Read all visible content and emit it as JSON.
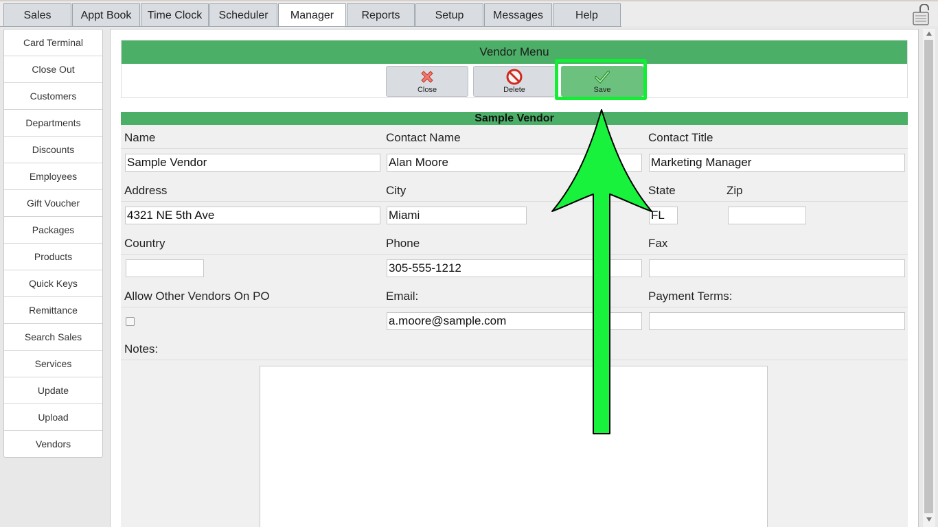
{
  "tabs": [
    {
      "label": "Sales",
      "active": false
    },
    {
      "label": "Appt Book",
      "active": false
    },
    {
      "label": "Time Clock",
      "active": false
    },
    {
      "label": "Scheduler",
      "active": false
    },
    {
      "label": "Manager",
      "active": true
    },
    {
      "label": "Reports",
      "active": false
    },
    {
      "label": "Setup",
      "active": false
    },
    {
      "label": "Messages",
      "active": false
    },
    {
      "label": "Help",
      "active": false
    }
  ],
  "sidebar": {
    "items": [
      "Card Terminal",
      "Close Out",
      "Customers",
      "Departments",
      "Discounts",
      "Employees",
      "Gift Voucher",
      "Packages",
      "Products",
      "Quick Keys",
      "Remittance",
      "Search Sales",
      "Services",
      "Update",
      "Upload",
      "Vendors"
    ]
  },
  "vendor_menu": {
    "title": "Vendor Menu",
    "close_label": "Close",
    "delete_label": "Delete",
    "save_label": "Save"
  },
  "form": {
    "title": "Sample Vendor",
    "labels": {
      "name": "Name",
      "contact_name": "Contact Name",
      "contact_title": "Contact Title",
      "address": "Address",
      "city": "City",
      "state": "State",
      "zip": "Zip",
      "country": "Country",
      "phone": "Phone",
      "fax": "Fax",
      "allow_other": "Allow Other Vendors On PO",
      "email": "Email:",
      "payment_terms": "Payment Terms:",
      "notes": "Notes:"
    },
    "values": {
      "name": "Sample Vendor",
      "contact_name": "Alan Moore",
      "contact_title": "Marketing Manager",
      "address": "4321 NE 5th Ave",
      "city": "Miami",
      "state": "FL",
      "zip": "",
      "country": "",
      "phone": "305-555-1212",
      "fax": "",
      "email": "a.moore@sample.com",
      "payment_terms": "",
      "notes": ""
    }
  },
  "colors": {
    "header_green": "#4caf68",
    "highlight_green": "#11ee33"
  }
}
